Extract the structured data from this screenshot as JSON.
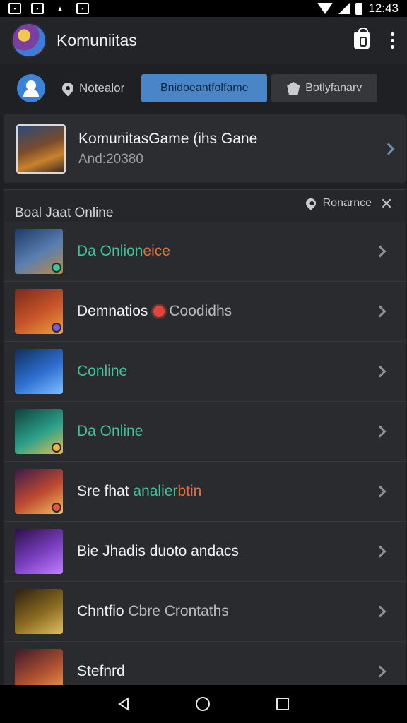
{
  "status_bar": {
    "time": "12:43"
  },
  "app_bar": {
    "title": "Komuniitas"
  },
  "tabs": {
    "plain": "Notealor",
    "active": "Bnidoeantfolfame",
    "dark": "Botlyfanarv"
  },
  "featured": {
    "title": "KomunitasGame (ihs Gane",
    "subtitle": "And:20380"
  },
  "list": {
    "header": "Boal Jaat Online",
    "filter_label": "Ronarnce",
    "rows": [
      {
        "parts": [
          {
            "t": "Da Onlion",
            "c": "g"
          },
          {
            "t": "eice",
            "c": "o"
          }
        ],
        "thumb": [
          "#1c3a6b",
          "#5a7fb0",
          "#c08a3e"
        ],
        "dot": "#3fc49b"
      },
      {
        "parts": [
          {
            "t": "Demnatios",
            "c": ""
          },
          {
            "t": "Coodidhs",
            "c": "m",
            "gear": true
          }
        ],
        "thumb": [
          "#7a2a1a",
          "#c8552a",
          "#f0a040"
        ],
        "dot": "#7c5cd6"
      },
      {
        "parts": [
          {
            "t": "Conline",
            "c": "g"
          }
        ],
        "thumb": [
          "#0f2f5a",
          "#2e6fd0",
          "#7fc0ff"
        ],
        "dot": ""
      },
      {
        "parts": [
          {
            "t": "Da Online",
            "c": "g"
          }
        ],
        "thumb": [
          "#10403a",
          "#2aa08a",
          "#e0c050"
        ],
        "dot": "#f0b640"
      },
      {
        "parts": [
          {
            "t": "Sre fhat ",
            "c": ""
          },
          {
            "t": "analier",
            "c": "g"
          },
          {
            "t": "btin",
            "c": "o"
          }
        ],
        "thumb": [
          "#3a1a4a",
          "#c04a30",
          "#f0c060"
        ],
        "dot": "#e05a47"
      },
      {
        "parts": [
          {
            "t": "Bie Jhadis duoto andacs",
            "c": ""
          }
        ],
        "thumb": [
          "#2a0f4a",
          "#7a3fc0",
          "#c080ff"
        ],
        "dot": ""
      },
      {
        "parts": [
          {
            "t": "Chntfio ",
            "c": ""
          },
          {
            "t": "Cbre Crontaths",
            "c": "m"
          }
        ],
        "thumb": [
          "#2a2010",
          "#8a6a20",
          "#e0c060"
        ],
        "dot": ""
      },
      {
        "parts": [
          {
            "t": "Stefnrd",
            "c": ""
          }
        ],
        "thumb": [
          "#3a1a2a",
          "#b05030",
          "#f0a050"
        ],
        "dot": ""
      }
    ]
  },
  "colors": {
    "accent": "#4a86c7",
    "green_text": "#3fc49b",
    "orange_text": "#e86c3a",
    "background": "#1f2023"
  },
  "icons": {
    "app_logo": "app-logo-icon",
    "bag": "bag-icon",
    "more": "more-vert-icon",
    "avatar": "user-icon",
    "pin": "pin-icon",
    "badge": "shield-icon",
    "close": "close-icon",
    "chevron": "chevron-right-icon",
    "back": "back-icon",
    "home": "home-icon",
    "recents": "recents-icon"
  }
}
